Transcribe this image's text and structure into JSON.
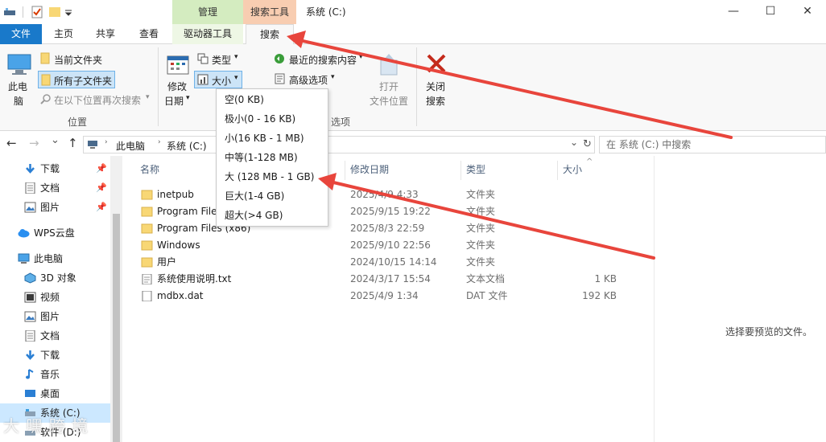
{
  "title": {
    "context_manage": "管理",
    "context_search": "搜索工具",
    "window_title": "系统 (C:)",
    "minimize": "—",
    "maximize": "☐",
    "close": "✕"
  },
  "tabs": {
    "file": "文件",
    "home": "主页",
    "share": "共享",
    "view": "查看",
    "drive_tools": "驱动器工具",
    "search": "搜索"
  },
  "ribbon": {
    "this_pc": [
      "此电",
      "脑"
    ],
    "current_folder": "当前文件夹",
    "all_subfolders": "所有子文件夹",
    "search_again": "在以下位置再次搜索",
    "search_again_arrow": "▾",
    "location_group": "位置",
    "date_modified": [
      "修改",
      "日期"
    ],
    "date_arrow": "▾",
    "kind": "类型",
    "kind_arrow": "▾",
    "size": "大小",
    "size_arrow": "▾",
    "recent_searches": "最近的搜索内容",
    "recent_arrow": "▾",
    "advanced": "高级选项",
    "advanced_arrow": "▾",
    "open_location": [
      "打开",
      "文件位置"
    ],
    "close_search": [
      "关闭",
      "搜索"
    ],
    "options_group": "选项"
  },
  "size_menu": [
    "空(0 KB)",
    "极小(0 - 16 KB)",
    "小(16 KB - 1 MB)",
    "中等(1-128 MB)",
    "大 (128 MB - 1 GB)",
    "巨大(1-4 GB)",
    "超大(>4 GB)"
  ],
  "address": {
    "back": "←",
    "forward": "→",
    "recent": "⌄",
    "up": "↑",
    "crumb_pc": "此电脑",
    "crumb_sep": "›",
    "crumb_drive": "系统 (C:)",
    "dropdown": "⌄",
    "refresh": "↻",
    "search_placeholder": "在 系统 (C:) 中搜索"
  },
  "nav": [
    {
      "label": "下载",
      "pinned": true
    },
    {
      "label": "文档",
      "pinned": true
    },
    {
      "label": "图片",
      "pinned": true
    },
    {
      "label": "WPS云盘",
      "pinned": false
    },
    {
      "label": "此电脑",
      "pinned": false
    },
    {
      "label": "3D 对象",
      "pinned": false
    },
    {
      "label": "视频",
      "pinned": false
    },
    {
      "label": "图片",
      "pinned": false
    },
    {
      "label": "文档",
      "pinned": false
    },
    {
      "label": "下载",
      "pinned": false
    },
    {
      "label": "音乐",
      "pinned": false
    },
    {
      "label": "桌面",
      "pinned": false
    },
    {
      "label": "系统 (C:)",
      "pinned": false
    },
    {
      "label": "软件 (D:)",
      "pinned": false
    }
  ],
  "pin_glyph": "📌",
  "columns": {
    "name": "名称",
    "date": "修改日期",
    "type": "类型",
    "size": "大小",
    "sort_arrow": "^"
  },
  "files": [
    {
      "name": "inetpub",
      "date": "2025/4/9 4:33",
      "type": "文件夹",
      "size": ""
    },
    {
      "name": "Program Files",
      "date": "2025/9/15 19:22",
      "type": "文件夹",
      "size": ""
    },
    {
      "name": "Program Files (x86)",
      "date": "2025/8/3 22:59",
      "type": "文件夹",
      "size": ""
    },
    {
      "name": "Windows",
      "date": "2025/9/10 22:56",
      "type": "文件夹",
      "size": ""
    },
    {
      "name": "用户",
      "date": "2024/10/15 14:14",
      "type": "文件夹",
      "size": ""
    },
    {
      "name": "系统使用说明.txt",
      "date": "2024/3/17 15:54",
      "type": "文本文档",
      "size": "1 KB"
    },
    {
      "name": "mdbx.dat",
      "date": "2025/4/9 1:34",
      "type": "DAT 文件",
      "size": "192 KB"
    }
  ],
  "preview_text": "选择要预览的文件。",
  "watermark": "大 嘿 跨 境",
  "colors": {
    "accent_blue": "#1979ca",
    "manage_green": "#d4ecc0",
    "search_orange": "#f8cdb1",
    "annotation_red": "#e8453c",
    "folder_yellow": "#f8d775"
  }
}
